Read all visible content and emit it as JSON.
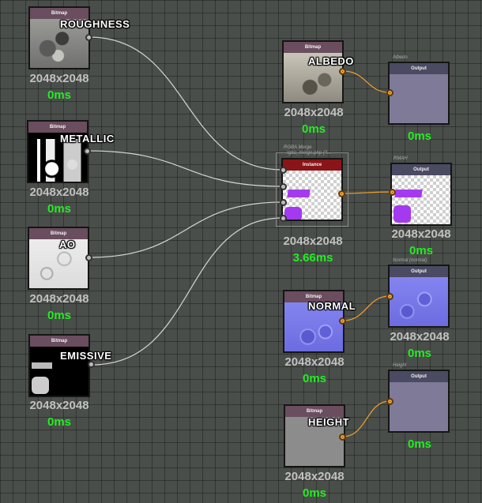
{
  "bitmap_label": "Bitmap",
  "output_label": "Output",
  "instance_label": "Instance",
  "nodes": {
    "roughness": {
      "tag": "ROUGHNESS",
      "res": "2048x2048",
      "time": "0ms"
    },
    "metallic": {
      "tag": "METALLIC",
      "res": "2048x2048",
      "time": "0ms"
    },
    "ao": {
      "tag": "AO",
      "res": "2048x2048",
      "time": "0ms"
    },
    "emissive": {
      "tag": "EMISSIVE",
      "res": "2048x2048",
      "time": "0ms"
    },
    "albedo": {
      "tag": "ALBEDO",
      "res": "2048x2048",
      "time": "0ms"
    },
    "normal": {
      "tag": "NORMAL",
      "res": "2048x2048",
      "time": "0ms"
    },
    "height": {
      "tag": "HEIGHT",
      "res": "2048x2048",
      "time": "0ms"
    },
    "rgba_merge": {
      "caption": "RGBA Merge",
      "subcaption": "rgba_merge.php (?...",
      "res": "2048x2048",
      "time": "3.66ms"
    },
    "out_albedo": {
      "caption": "Albedo",
      "time": "0ms"
    },
    "out_rmah": {
      "caption": "RMAH",
      "res": "2048x2048",
      "time": "0ms"
    },
    "out_normal": {
      "caption": "Normal (normal)",
      "res": "2048x2048",
      "time": "0ms"
    },
    "out_height": {
      "caption": "Height",
      "time": "0ms"
    }
  },
  "colors": {
    "wire_grey": "#d4d4d4",
    "wire_orange": "#f0a030",
    "time_green": "#22ee22"
  }
}
